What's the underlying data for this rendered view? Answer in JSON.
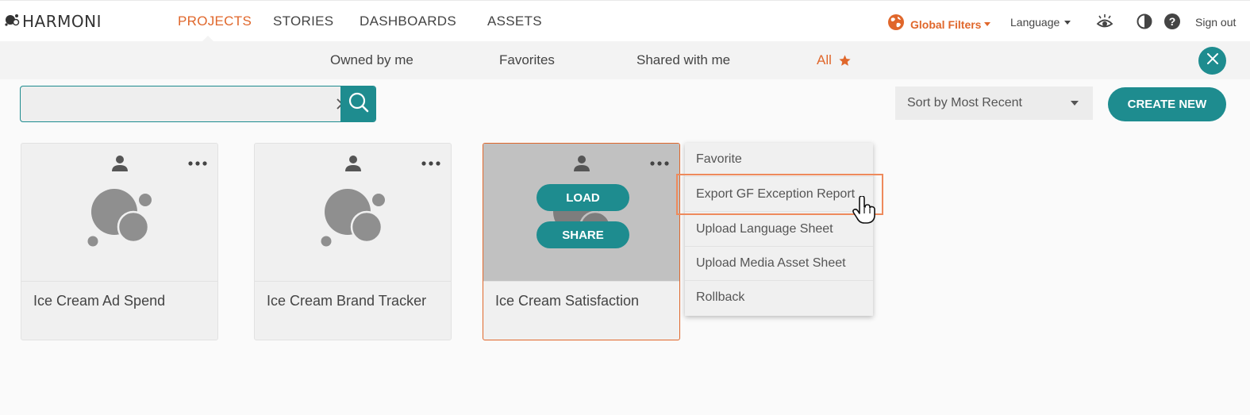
{
  "app": {
    "logo_text": "HARMONI"
  },
  "nav": {
    "items": [
      {
        "label": "PROJECTS",
        "active": true
      },
      {
        "label": "STORIES",
        "active": false
      },
      {
        "label": "DASHBOARDS",
        "active": false
      },
      {
        "label": "ASSETS",
        "active": false
      }
    ]
  },
  "header": {
    "global_filters": "Global Filters",
    "language": "Language",
    "sign_out": "Sign out"
  },
  "filters": {
    "tabs": [
      {
        "label": "Owned by me",
        "active": false
      },
      {
        "label": "Favorites",
        "active": false
      },
      {
        "label": "Shared with me",
        "active": false
      },
      {
        "label": "All",
        "active": true
      }
    ]
  },
  "search": {
    "value": "",
    "placeholder": ""
  },
  "sort": {
    "selected": "Sort by Most Recent"
  },
  "create_label": "CREATE NEW",
  "projects": [
    {
      "title": "Ice Cream Ad Spend"
    },
    {
      "title": "Ice Cream Brand Tracker"
    },
    {
      "title": "Ice Cream Satisfaction",
      "selected": true,
      "load_label": "LOAD",
      "share_label": "SHARE"
    }
  ],
  "context_menu": {
    "items": [
      "Favorite",
      "Export GF Exception Report",
      "Upload Language Sheet",
      "Upload Media Asset Sheet",
      "Rollback"
    ],
    "hovered_index": 1
  },
  "colors": {
    "accent": "#e0672b",
    "teal": "#1e8c8f",
    "highlight": "#ee8a5c"
  },
  "icons": {
    "logo": "harmoni-logo-icon",
    "globe": "globe-icon",
    "eye": "eye-icon",
    "contrast": "contrast-icon",
    "help": "help-icon",
    "close": "close-icon",
    "search": "search-icon",
    "clear": "clear-icon",
    "user": "user-icon",
    "more": "more-icon",
    "cursor": "hand-pointer-icon"
  }
}
